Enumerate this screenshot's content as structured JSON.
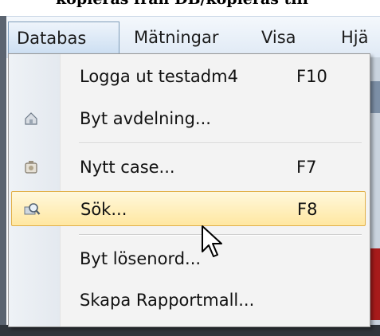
{
  "title_fragment": "kopieras från DB/kopieras till",
  "menubar": {
    "items": [
      {
        "label": "Databas",
        "open": true
      },
      {
        "label": "Mätningar"
      },
      {
        "label": "Visa"
      },
      {
        "label": "Hjä"
      }
    ]
  },
  "menu": {
    "items": [
      {
        "label": "Logga ut testadm4",
        "shortcut": "F10",
        "icon": null
      },
      {
        "label": "Byt avdelning...",
        "shortcut": "",
        "icon": "department-icon"
      },
      {
        "label": "Nytt case...",
        "shortcut": "F7",
        "icon": "new-case-icon"
      },
      {
        "label": "Sök...",
        "shortcut": "F8",
        "icon": "search-icon",
        "highlighted": true
      },
      {
        "label": "Byt lösenord...",
        "shortcut": "",
        "icon": null
      },
      {
        "label": "Skapa Rapportmall...",
        "shortcut": "",
        "icon": null
      }
    ]
  },
  "colors": {
    "highlight_fill": "#ffe7a1",
    "highlight_border": "#e2b04a",
    "menubar_bg": "#dfe9f5",
    "menu_bg": "#f3f3f3"
  }
}
